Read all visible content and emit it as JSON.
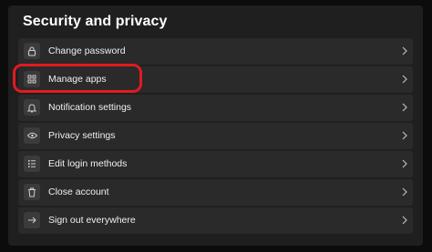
{
  "section": {
    "title": "Security and privacy"
  },
  "items": [
    {
      "label": "Change password",
      "icon": "lock-icon"
    },
    {
      "label": "Manage apps",
      "icon": "grid-icon"
    },
    {
      "label": "Notification settings",
      "icon": "bell-icon"
    },
    {
      "label": "Privacy settings",
      "icon": "eye-icon"
    },
    {
      "label": "Edit login methods",
      "icon": "list-icon"
    },
    {
      "label": "Close account",
      "icon": "trash-icon"
    },
    {
      "label": "Sign out everywhere",
      "icon": "sign-out-icon"
    }
  ],
  "highlight": {
    "target": "Manage apps",
    "color": "#e01a22"
  },
  "colors": {
    "background": "#0c0c0c",
    "panel": "#1f1f1f",
    "row": "#2a2a2a",
    "text": "#f0f0f0"
  }
}
